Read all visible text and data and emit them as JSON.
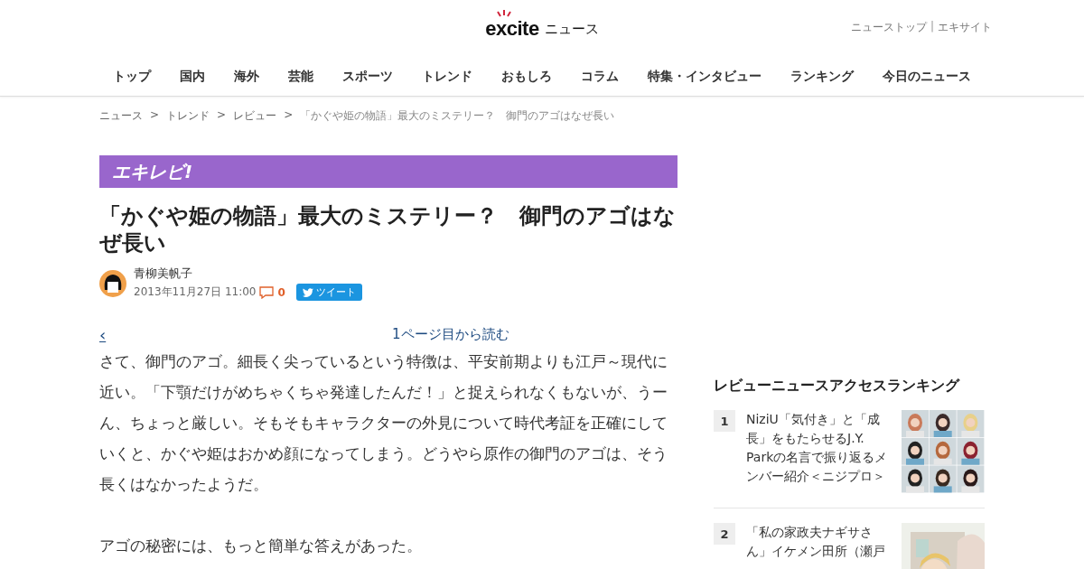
{
  "header": {
    "logo": {
      "brand": "excite",
      "suffix": "ニュース"
    },
    "links": [
      "ニューストップ",
      "エキサイト"
    ],
    "link_separator": "|"
  },
  "nav": [
    {
      "label": "トップ"
    },
    {
      "label": "国内"
    },
    {
      "label": "海外"
    },
    {
      "label": "芸能"
    },
    {
      "label": "スポーツ"
    },
    {
      "label": "トレンド"
    },
    {
      "label": "おもしろ"
    },
    {
      "label": "コラム"
    },
    {
      "label": "特集・インタビュー"
    },
    {
      "label": "ランキング"
    },
    {
      "label": "今日のニュース"
    }
  ],
  "breadcrumb": [
    "ニュース",
    "トレンド",
    "レビュー",
    "「かぐや姫の物語」最大のミステリー？　御門のアゴはなぜ長い"
  ],
  "breadcrumb_separator": ">",
  "article": {
    "banner": "エキレビ!",
    "title": "「かぐや姫の物語」最大のミステリー？　御門のアゴはなぜ長い",
    "author": "青柳美帆子",
    "date": "2013年11月27日 11:00",
    "comment_count": "0",
    "tweet_button": "ツイート",
    "prev_arrow": "‹",
    "first_page_link": "1ページ目から読む",
    "paragraphs": [
      "さて、御門のアゴ。細長く尖っているという特徴は、平安前期よりも江戸～現代に近い。「下顎だけがめちゃくちゃ発達したんだ！」と捉えられなくもないが、うーん、ちょっと厳しい。そもそもキャラクターの外見について時代考証を正確にしていくと、かぐや姫はおかめ顔になってしまう。どうやら原作の御門のアゴは、そう長くはなかったようだ。",
      "アゴの秘密には、もっと簡単な答えがあった。"
    ]
  },
  "ranking": {
    "title": "レビューニュースアクセスランキング",
    "items": [
      {
        "rank": "1",
        "headline": "NiziU「気付き」と「成長」をもたらせるJ.Y. Parkの名言で振り返るメンバー紹介＜ニジプロ＞"
      },
      {
        "rank": "2",
        "headline": "「私の家政夫ナギサさん」イケメン田所（瀬戸"
      }
    ]
  }
}
